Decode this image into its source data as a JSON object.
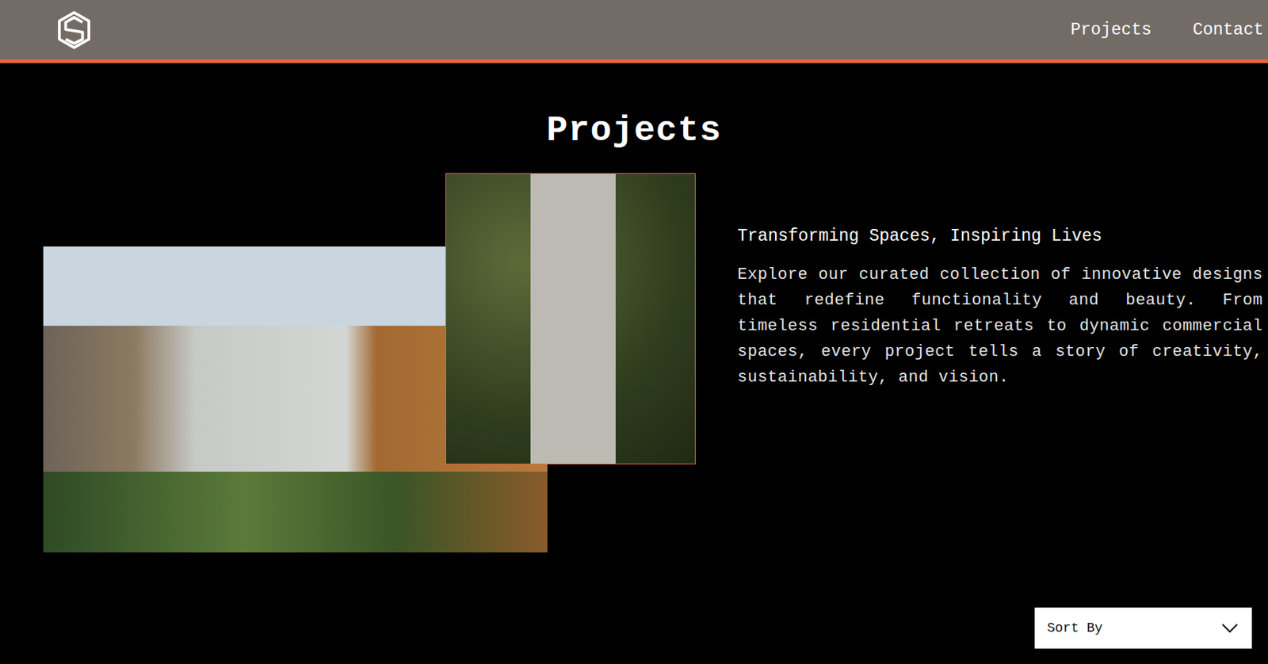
{
  "header": {
    "nav": [
      {
        "label": "Projects"
      },
      {
        "label": "Contact"
      }
    ]
  },
  "page": {
    "title": "Projects"
  },
  "intro": {
    "heading": "Transforming Spaces, Inspiring Lives",
    "body": "Explore our curated collection of innovative designs that redefine functionality and beauty. From timeless residential retreats to dynamic commercial spaces, every project tells a story of creativity, sustainability, and vision."
  },
  "sort": {
    "label": "Sort By"
  }
}
